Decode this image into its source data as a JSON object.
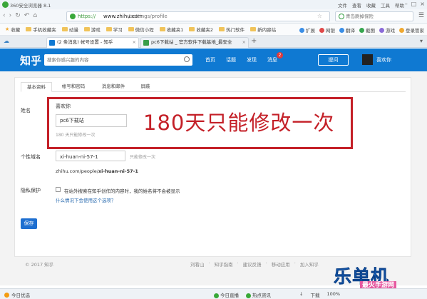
{
  "browser": {
    "title": "360安全浏览器 8.1",
    "top_menu": [
      "文件",
      "查看",
      "收藏",
      "工具",
      "帮助"
    ],
    "url": {
      "scheme": "https://",
      "host": "www.zhihu.com",
      "path": "/settings/profile"
    },
    "search_placeholder": "青岛刷掉保险",
    "bookmarks": [
      "收藏",
      "手机收藏夹",
      "动漫",
      "游戏",
      "学习",
      "微信小程",
      "收藏夹1",
      "收藏夹2",
      "热门软件",
      "新内容站"
    ],
    "bookmarks_right": [
      "扩展",
      "网银",
      "翻译",
      "截图",
      "游戏",
      "登录管家"
    ],
    "tabs": [
      {
        "label": "(2 条消息) 帐号设置 - 知乎",
        "active": true
      },
      {
        "label": "pc6下载站 _ 官方软件下载基地_最安全",
        "active": false
      }
    ]
  },
  "zhihu": {
    "logo": "知乎",
    "search_placeholder": "搜索你感兴趣的内容",
    "nav": [
      "首页",
      "话题",
      "发现",
      "消息"
    ],
    "message_badge": "2",
    "ask_button": "提问",
    "username": "喜欢你"
  },
  "settings": {
    "tabs": [
      "基本资料",
      "帐号和密码",
      "消息和邮件",
      "屏蔽"
    ],
    "name_label": "姓名",
    "name_current": "喜欢你",
    "name_input": "pc6下载站",
    "name_hint": "180 天只能修改一次",
    "overlay_text": "180天只能修改一次",
    "domain_label": "个性域名",
    "domain_input": "xi-huan-ni-57-1",
    "domain_hint": "只能修改一次",
    "domain_url_prefix": "zhihu.com/people/",
    "domain_url_slug": "xi-huan-ni-57-1",
    "privacy_label": "隐私保护",
    "privacy_checkbox_text": "在站外搜索在知乎创作的内容时，我的姓名将不会被显示",
    "privacy_link": "什么情况下会使用这个选项？",
    "save_button": "保存"
  },
  "footer": {
    "copyright": "© 2017 知乎",
    "links": [
      "刘看山",
      "知乎指南",
      "建议反馈",
      "移动应用",
      "加入知乎"
    ]
  },
  "watermark": {
    "main": "乐单机",
    "sub": "最火手游网"
  },
  "statusbar": {
    "left": "今日优选",
    "middle": [
      "今日直播",
      "热点资讯"
    ],
    "right_items": [
      "↓",
      "下载",
      "100%"
    ]
  }
}
